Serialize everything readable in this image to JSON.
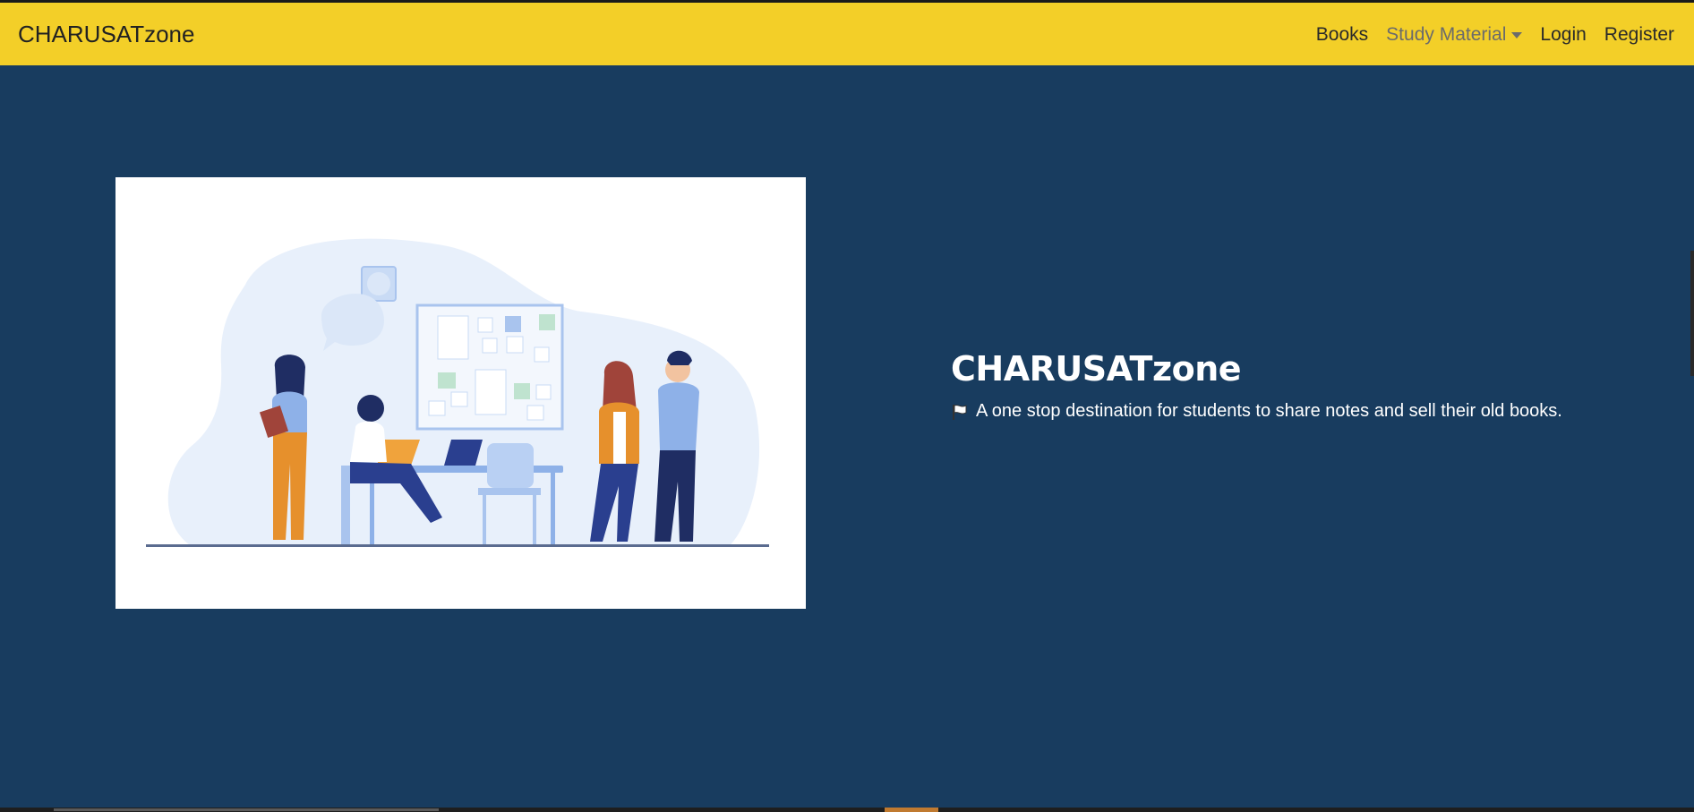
{
  "navbar": {
    "brand": "CHARUSATzone",
    "items": [
      {
        "label": "Books"
      },
      {
        "label": "Study Material"
      },
      {
        "label": "Login"
      },
      {
        "label": "Register"
      }
    ]
  },
  "hero": {
    "title": "CHARUSATzone",
    "subtitle": "A one stop destination for students to share notes and sell their old books.",
    "subtitle_icon": "flag-icon",
    "illustration": "team-meeting-illustration"
  },
  "colors": {
    "navbar_bg": "#f3cf28",
    "page_bg": "#183c5f",
    "text_light": "#ffffff"
  }
}
